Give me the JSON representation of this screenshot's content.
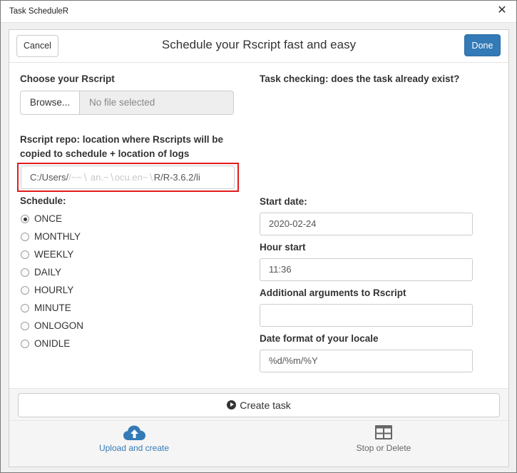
{
  "window": {
    "title": "Task ScheduleR",
    "close_glyph": "✕"
  },
  "header": {
    "cancel_label": "Cancel",
    "title": "Schedule your Rscript fast and easy",
    "done_label": "Done"
  },
  "script_chooser": {
    "label": "Choose your Rscript",
    "browse_label": "Browse...",
    "file_placeholder": "No file selected"
  },
  "task_check": {
    "label": "Task checking: does the task already exist?"
  },
  "repo": {
    "label_line1": "Rscript repo: location where Rscripts will be",
    "label_line2": "copied to schedule + location of logs",
    "value_start": "C:/Users/",
    "value_obscured": "  ",
    "value_end": "R/R-3.6.2/li"
  },
  "schedule": {
    "label": "Schedule:",
    "selected": "ONCE",
    "options": [
      "ONCE",
      "MONTHLY",
      "WEEKLY",
      "DAILY",
      "HOURLY",
      "MINUTE",
      "ONLOGON",
      "ONIDLE"
    ]
  },
  "start_date": {
    "label": "Start date:",
    "value": "2020-02-24"
  },
  "hour_start": {
    "label": "Hour start",
    "value": "11:36"
  },
  "additional_args": {
    "label": "Additional arguments to Rscript",
    "value": ""
  },
  "date_format": {
    "label": "Date format of your locale",
    "value": "%d/%m/%Y"
  },
  "create_task": {
    "label": "Create task"
  },
  "tabs": [
    {
      "label": "Upload and create",
      "icon": "cloud-upload-icon",
      "active": true
    },
    {
      "label": "Stop or Delete",
      "icon": "table-icon",
      "active": false
    }
  ],
  "colors": {
    "primary": "#337ab7",
    "highlight": "#e21b1b"
  }
}
